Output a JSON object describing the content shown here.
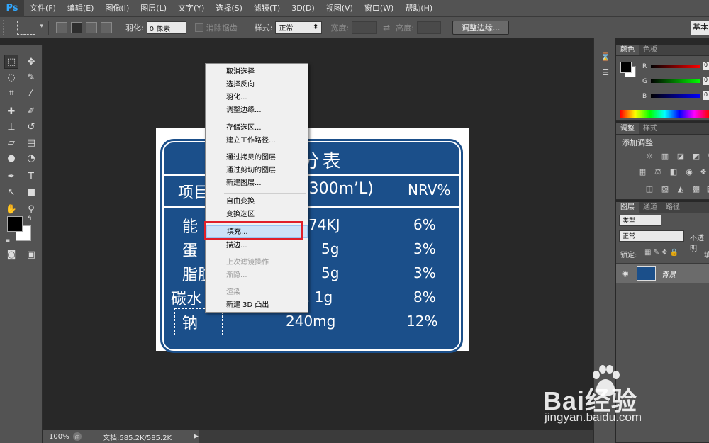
{
  "app": {
    "logo": "Ps"
  },
  "menubar": {
    "items": [
      "文件(F)",
      "编辑(E)",
      "图像(I)",
      "图层(L)",
      "文字(Y)",
      "选择(S)",
      "滤镜(T)",
      "3D(D)",
      "视图(V)",
      "窗口(W)",
      "帮助(H)"
    ]
  },
  "options": {
    "feather_label": "羽化:",
    "feather_value": "0 像素",
    "antialias_label": "消除锯齿",
    "style_label": "样式:",
    "style_value": "正常",
    "width_label": "宽度:",
    "height_label": "高度:",
    "refine_edge_label": "调整边缘...",
    "workspace_label": "基本"
  },
  "document": {
    "title": "成分表",
    "header": {
      "left": "项目",
      "mid": "(300m’L)",
      "right": "NRV%"
    },
    "rows": [
      {
        "name": "能",
        "value": "74KJ",
        "nrv": "6%"
      },
      {
        "name": "蛋",
        "value": "5g",
        "nrv": "3%"
      },
      {
        "name": "脂肪",
        "value": "5g",
        "nrv": "3%"
      },
      {
        "name": "碳水",
        "value": ". 1g",
        "nrv": "8%"
      },
      {
        "name": "钠",
        "value": "240mg",
        "nrv": "12%"
      }
    ]
  },
  "context_menu": {
    "items": [
      {
        "label": "取消选择",
        "disabled": false
      },
      {
        "label": "选择反向",
        "disabled": false
      },
      {
        "label": "羽化...",
        "disabled": false
      },
      {
        "label": "调整边缘...",
        "disabled": false
      },
      {
        "label": "存储选区...",
        "disabled": false
      },
      {
        "label": "建立工作路径...",
        "disabled": false
      },
      {
        "label": "通过拷贝的图层",
        "disabled": false
      },
      {
        "label": "通过剪切的图层",
        "disabled": false
      },
      {
        "label": "新建图层...",
        "disabled": false
      },
      {
        "label": "自由变换",
        "disabled": false
      },
      {
        "label": "变换选区",
        "disabled": false
      },
      {
        "label": "填充...",
        "disabled": false,
        "highlighted": true
      },
      {
        "label": "描边...",
        "disabled": false
      },
      {
        "label": "上次滤镜操作",
        "disabled": true
      },
      {
        "label": "渐隐...",
        "disabled": true
      },
      {
        "label": "渲染",
        "disabled": true
      },
      {
        "label": "新建 3D 凸出",
        "disabled": false
      }
    ]
  },
  "statusbar": {
    "zoom": "100%",
    "doc_info": "文档:585.2K/585.2K"
  },
  "panels": {
    "color": {
      "tabs": [
        "颜色",
        "色板"
      ],
      "r_label": "R",
      "g_label": "G",
      "b_label": "B",
      "r_value": "0",
      "g_value": "0",
      "b_value": "0"
    },
    "adjust": {
      "tabs": [
        "调整",
        "样式"
      ],
      "heading": "添加调整"
    },
    "layers": {
      "tabs": [
        "图层",
        "通道",
        "路径"
      ],
      "kind": "类型",
      "blend": "正常",
      "opacity_label": "不透明",
      "lock_label": "锁定:",
      "fill_label": "填",
      "layer_name": "背景"
    }
  },
  "watermark": {
    "brand": "Bai经验",
    "url": "jingyan.baidu.com"
  },
  "colors": {
    "sign_blue": "#1b4f8a",
    "highlight": "#cde2f7",
    "red_box": "#e0202a"
  }
}
